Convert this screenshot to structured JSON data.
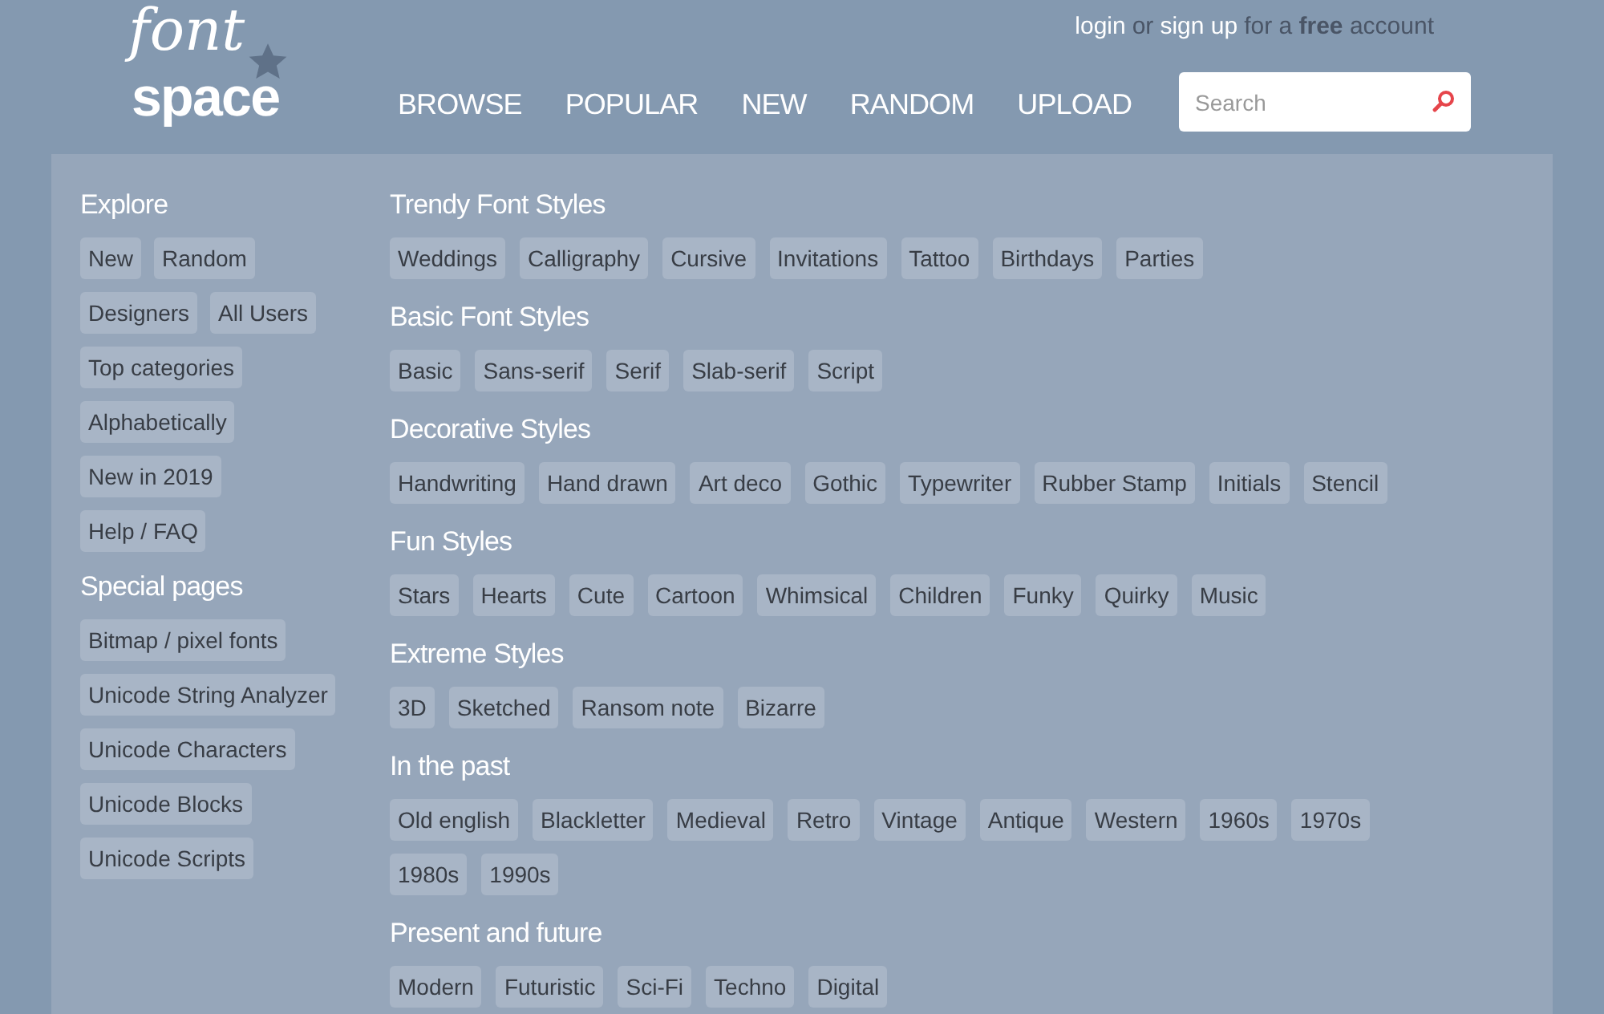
{
  "logo": {
    "top": "font",
    "bottom": "space"
  },
  "account": [
    {
      "kind": "link",
      "text": "login"
    },
    {
      "kind": "text",
      "text": "or"
    },
    {
      "kind": "link",
      "text": "sign up"
    },
    {
      "kind": "text",
      "text": "for a **free** account"
    }
  ],
  "nav": [
    "BROWSE",
    "POPULAR",
    "NEW",
    "RANDOM",
    "UPLOAD"
  ],
  "search": {
    "placeholder": "Search"
  },
  "sidebar": [
    {
      "title": "Explore",
      "rows": [
        [
          "New",
          "Random"
        ],
        [
          "Designers",
          "All Users"
        ],
        [
          "Top categories"
        ],
        [
          "Alphabetically"
        ],
        [
          "New in 2019"
        ],
        [
          "Help / FAQ"
        ]
      ]
    },
    {
      "title": "Special pages",
      "rows": [
        [
          "Bitmap / pixel fonts"
        ],
        [
          "Unicode String Analyzer"
        ],
        [
          "Unicode Characters"
        ],
        [
          "Unicode Blocks"
        ],
        [
          "Unicode Scripts"
        ]
      ]
    }
  ],
  "sections": [
    {
      "title": "Trendy Font Styles",
      "tags": [
        "Weddings",
        "Calligraphy",
        "Cursive",
        "Invitations",
        "Tattoo",
        "Birthdays",
        "Parties"
      ]
    },
    {
      "title": "Basic Font Styles",
      "tags": [
        "Basic",
        "Sans-serif",
        "Serif",
        "Slab-serif",
        "Script"
      ]
    },
    {
      "title": "Decorative Styles",
      "tags": [
        "Handwriting",
        "Hand drawn",
        "Art deco",
        "Gothic",
        "Typewriter",
        "Rubber Stamp",
        "Initials",
        "Stencil"
      ]
    },
    {
      "title": "Fun Styles",
      "tags": [
        "Stars",
        "Hearts",
        "Cute",
        "Cartoon",
        "Whimsical",
        "Children",
        "Funky",
        "Quirky",
        "Music"
      ]
    },
    {
      "title": "Extreme Styles",
      "tags": [
        "3D",
        "Sketched",
        "Ransom note",
        "Bizarre"
      ]
    },
    {
      "title": "In the past",
      "tags": [
        "Old english",
        "Blackletter",
        "Medieval",
        "Retro",
        "Vintage",
        "Antique",
        "Western",
        "1960s",
        "1970s",
        "1980s",
        "1990s"
      ]
    },
    {
      "title": "Present and future",
      "tags": [
        "Modern",
        "Futuristic",
        "Sci-Fi",
        "Techno",
        "Digital"
      ]
    }
  ]
}
